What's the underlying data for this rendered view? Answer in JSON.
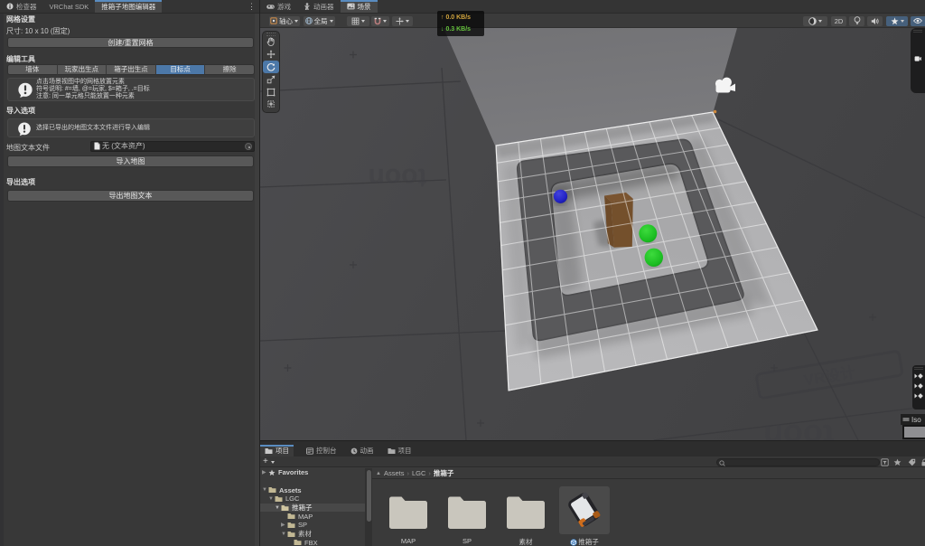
{
  "inspector": {
    "tabs": [
      {
        "label": "检查器"
      },
      {
        "label": "VRChat SDK"
      },
      {
        "label": "推箱子地图编辑器"
      }
    ],
    "grid_settings": {
      "title": "网格设置",
      "size_label": "尺寸: 10 x 10 (固定)",
      "create_button": "创建/重置网格"
    },
    "edit_tools": {
      "title": "编辑工具",
      "tools": [
        "墙体",
        "玩家出生点",
        "箱子出生点",
        "目标点",
        "擦除"
      ],
      "active_tool": "目标点",
      "help_lines": [
        "点击场景视图中的网格放置元素",
        "符号说明: #=墙, @=玩家, $=箱子, .=目标",
        "注意: 同一单元格只能放置一种元素"
      ]
    },
    "import_options": {
      "title": "导入选项",
      "help": "选择已导出的地图文本文件进行导入编辑",
      "file_label": "地图文本文件",
      "file_value": "无 (文本资产)",
      "import_button": "导入地图"
    },
    "export_options": {
      "title": "导出选项",
      "export_button": "导出地图文本"
    }
  },
  "scene": {
    "tabs": [
      {
        "label": "游戏"
      },
      {
        "label": "动画器"
      },
      {
        "label": "场景"
      }
    ],
    "active_tab": "场景",
    "toolbar": {
      "pivot": "轴心",
      "orientation": "全局",
      "mode_2d": "2D"
    },
    "stats": {
      "up": "0.0 KB/s",
      "down": "0.3 KB/s",
      "up_color": "#d2a53e",
      "down_color": "#65c23c"
    },
    "gizmo_label": "Iso",
    "watermark": "toon"
  },
  "project": {
    "tabs": [
      {
        "label": "项目"
      },
      {
        "label": "控制台"
      },
      {
        "label": "动画"
      },
      {
        "label": "项目"
      }
    ],
    "active_tab": "项目",
    "breadcrumb": {
      "root": "Assets",
      "mid": "LGC",
      "leaf": "推箱子"
    },
    "tree": {
      "favorites": "Favorites",
      "assets": "Assets",
      "lgc": "LGC",
      "tuixiangzi": "推箱子",
      "map": "MAP",
      "sp": "SP",
      "sucai": "素材",
      "fbx": "FBX"
    },
    "selected_tree_item": "推箱子",
    "items": [
      {
        "label": "MAP",
        "type": "folder"
      },
      {
        "label": "SP",
        "type": "folder"
      },
      {
        "label": "素材",
        "type": "folder"
      },
      {
        "label": "推箱子",
        "type": "prefab"
      }
    ],
    "selected_item": "推箱子"
  },
  "colors": {
    "accent_blue": "#4c78a8",
    "tab_indicator": "#5a8cc0",
    "panel_bg": "#383838",
    "selected_button": "#4c78a8"
  }
}
